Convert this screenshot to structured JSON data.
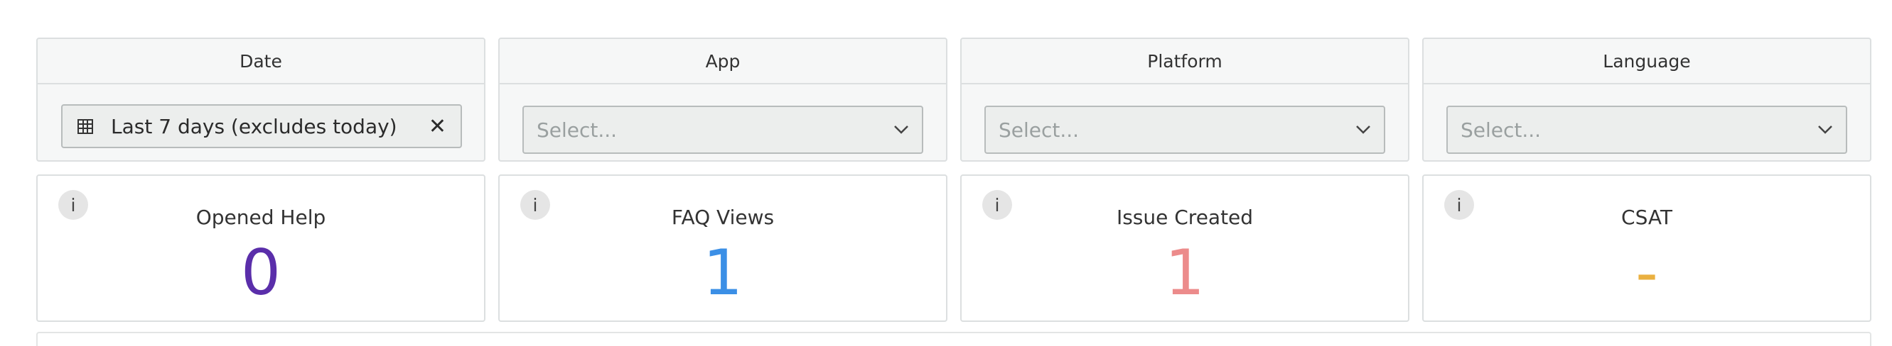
{
  "filters": [
    {
      "title": "Date",
      "value": "Last 7 days (excludes today)"
    },
    {
      "title": "App",
      "placeholder": "Select..."
    },
    {
      "title": "Platform",
      "placeholder": "Select..."
    },
    {
      "title": "Language",
      "placeholder": "Select..."
    }
  ],
  "kpis": [
    {
      "label": "Opened Help",
      "value": "0",
      "color": "#5a2eaa"
    },
    {
      "label": "FAQ Views",
      "value": "1",
      "color": "#3b8fe6"
    },
    {
      "label": "Issue Created",
      "value": "1",
      "color": "#ec8b8b"
    },
    {
      "label": "CSAT",
      "value": "-",
      "color": "#eab040"
    }
  ],
  "icons": {
    "info": "i",
    "clear": "✕"
  }
}
